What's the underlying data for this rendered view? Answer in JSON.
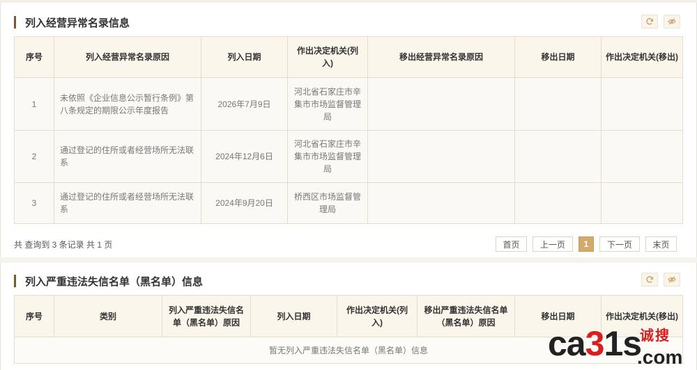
{
  "section1": {
    "title": "列入经营异常名录信息",
    "headers": [
      "序号",
      "列入经营异常名录原因",
      "列入日期",
      "作出决定机关(列入)",
      "移出经营异常名录原因",
      "移出日期",
      "作出决定机关(移出)"
    ],
    "rows": [
      {
        "no": "1",
        "reason": "未依照《企业信息公示暂行条例》第八条规定的期限公示年度报告",
        "date": "2026年7月9日",
        "authority": "河北省石家庄市辛集市市场监督管理局",
        "remove_reason": "",
        "remove_date": "",
        "remove_authority": ""
      },
      {
        "no": "2",
        "reason": "通过登记的住所或者经营场所无法联系",
        "date": "2024年12月6日",
        "authority": "河北省石家庄市辛集市市场监督管理局",
        "remove_reason": "",
        "remove_date": "",
        "remove_authority": ""
      },
      {
        "no": "3",
        "reason": "通过登记的住所或者经营场所无法联系",
        "date": "2024年9月20日",
        "authority": "桥西区市场监督管理局",
        "remove_reason": "",
        "remove_date": "",
        "remove_authority": ""
      }
    ],
    "summary": "共 查询到 3 条记录 共 1 页",
    "pager": {
      "first": "首页",
      "prev": "上一页",
      "current": "1",
      "next": "下一页",
      "last": "末页"
    }
  },
  "section2": {
    "title": "列入严重违法失信名单（黑名单）信息",
    "headers": [
      "序号",
      "类别",
      "列入严重违法失信名单（黑名单）原因",
      "列入日期",
      "作出决定机关(列入)",
      "移出严重违法失信名单（黑名单）原因",
      "移出日期",
      "作出决定机关(移出)"
    ],
    "empty_text": "暂无列入严重违法失信名单（黑名单）信息"
  },
  "icons": {
    "refresh": "refresh-icon",
    "hide": "eye-off-icon"
  },
  "colors": {
    "accent": "#7a5a2e",
    "active_page": "#d4aa6a",
    "brand_red": "#d81e1e"
  },
  "watermark": {
    "text_a": "ca",
    "text_b": "3",
    "text_c": "1s",
    "cn": "诚搜",
    "domain": ".com"
  }
}
